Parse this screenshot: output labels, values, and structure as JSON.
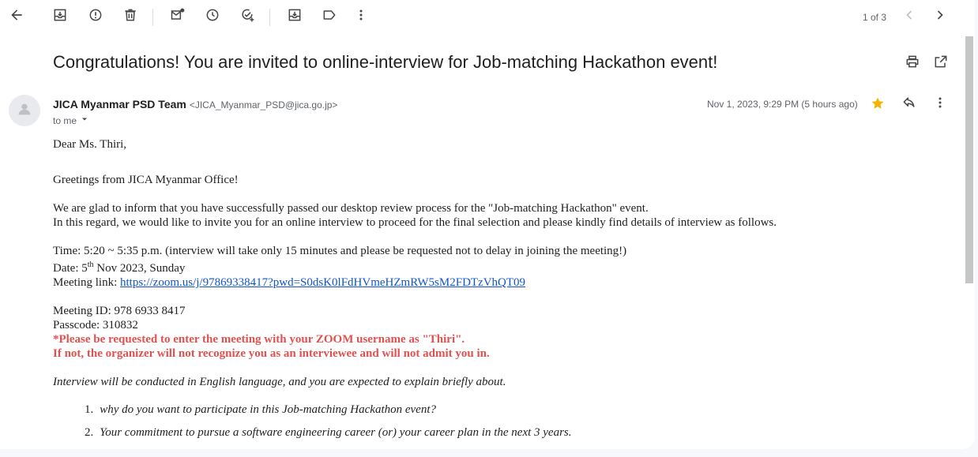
{
  "toolbar": {
    "pager": "1 of 3"
  },
  "email": {
    "subject": "Congratulations! You are invited to online-interview for Job-matching Hackathon event!",
    "sender_name": "JICA Myanmar PSD Team",
    "sender_email": "<JICA_Myanmar_PSD@jica.go.jp>",
    "to_label": "to me",
    "date": "Nov 1, 2023, 9:29 PM (5 hours ago)",
    "starred_color": "#f4b400",
    "accent_link_color": "#1155cc",
    "warning_color": "#e0524f"
  },
  "body": {
    "greeting": "Dear Ms. Thiri,",
    "line_greetings": "Greetings from JICA Myanmar Office!",
    "line_glad": "We are glad to inform that you have successfully passed our desktop review process for the \"Job-matching Hackathon\" event.",
    "line_regard": "In this regard, we would like to invite you for an online interview to proceed for the final selection and please kindly find details of interview as follows.",
    "time_line": "Time:  5:20 ~ 5:35 p.m. (interview will take only 15 minutes and please be requested not to delay in joining the meeting!)",
    "date_prefix": "Date: 5",
    "date_sup": "th",
    "date_suffix": " Nov 2023, Sunday",
    "meeting_link_label": "Meeting link: ",
    "meeting_link": "https://zoom.us/j/97869338417?pwd=S0dsK0lFdHVmeHZmRW5sM2FDTzVhQT09",
    "meeting_id": "Meeting ID: 978 6933 8417",
    "passcode": "Passcode: 310832",
    "warning_1": "*Please be requested to enter the meeting with your ZOOM username as \"Thiri\".",
    "warning_2": "If not, the organizer will not recognize you as an interviewee and will not admit you in.",
    "interview_note": "Interview will be conducted in English language, and you are expected to explain briefly about.",
    "list": [
      {
        "num": "1.",
        "text": "why do you want to participate in this Job-matching Hackathon event?"
      },
      {
        "num": "2.",
        "text": "Your commitment to pursue a software engineering career (or) your career plan in the next 3 years."
      }
    ]
  },
  "icons": [
    "back-arrow-icon",
    "archive-icon",
    "report-spam-icon",
    "delete-icon",
    "mark-unread-icon",
    "snooze-icon",
    "add-task-icon",
    "move-to-icon",
    "label-icon",
    "more-vert-icon",
    "chevron-left-icon",
    "chevron-right-icon",
    "print-icon",
    "open-new-window-icon",
    "avatar-person-icon",
    "star-icon",
    "reply-icon",
    "caret-down-icon"
  ]
}
